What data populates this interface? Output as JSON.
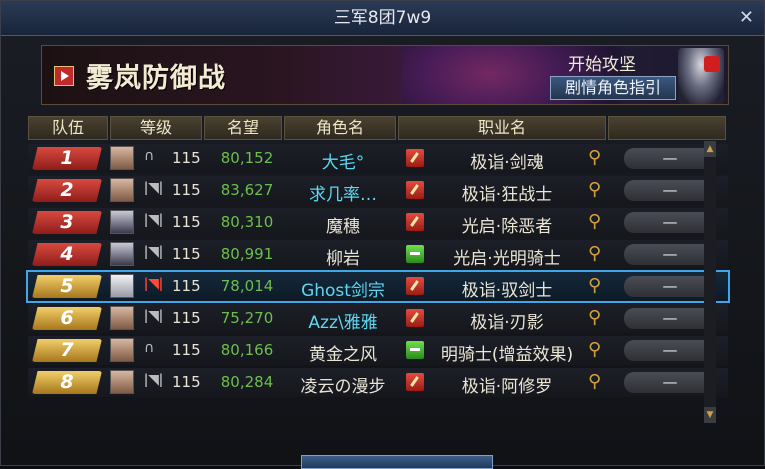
{
  "window": {
    "title": "三军8团7w9",
    "close_label": "✕"
  },
  "banner": {
    "title": "雾岚防御战",
    "start_text": "开始攻坚",
    "guide_button": "剧情角色指引"
  },
  "headers": [
    "队伍",
    "等级",
    "名望",
    "角色名",
    "职业名",
    ""
  ],
  "rows": [
    {
      "team": "1",
      "color": "red",
      "level": "115",
      "fame": "80,152",
      "name": "大毛°",
      "name_color": "cyan",
      "class": "极诣·剑魂",
      "class_icon": "red",
      "action": "—",
      "status_icon": "headset"
    },
    {
      "team": "2",
      "color": "red",
      "level": "115",
      "fame": "83,627",
      "name": "求几率…",
      "name_color": "cyan",
      "class": "极诣·狂战士",
      "class_icon": "red",
      "action": "—",
      "status_icon": "speaker"
    },
    {
      "team": "3",
      "color": "red",
      "level": "115",
      "fame": "80,310",
      "name": "魔穗",
      "name_color": "white",
      "class": "光启·除恶者",
      "class_icon": "red",
      "action": "—",
      "status_icon": "speaker"
    },
    {
      "team": "4",
      "color": "red",
      "level": "115",
      "fame": "80,991",
      "name": "柳岩",
      "name_color": "white",
      "class": "光启·光明骑士",
      "class_icon": "green",
      "action": "—",
      "status_icon": "speaker"
    },
    {
      "team": "5",
      "color": "gold",
      "level": "115",
      "fame": "78,014",
      "name": "Ghost剑宗",
      "name_color": "cyan",
      "class": "极诣·驭剑士",
      "class_icon": "red",
      "action": "—",
      "status_icon": "speaker-red"
    },
    {
      "team": "6",
      "color": "gold",
      "level": "115",
      "fame": "75,270",
      "name": "Azz\\雅雅",
      "name_color": "cyan",
      "class": "极诣·刃影",
      "class_icon": "red",
      "action": "—",
      "status_icon": "speaker"
    },
    {
      "team": "7",
      "color": "gold",
      "level": "115",
      "fame": "80,166",
      "name": "黄金之风",
      "name_color": "white",
      "class": "明骑士(增益效果)",
      "class_icon": "green",
      "action": "—",
      "status_icon": "headset"
    },
    {
      "team": "8",
      "color": "gold",
      "level": "115",
      "fame": "80,284",
      "name": "凌云の漫步",
      "name_color": "white",
      "class": "极诣·阿修罗",
      "class_icon": "red",
      "action": "—",
      "status_icon": "speaker"
    }
  ],
  "selected_row": 5,
  "colors": {
    "accent_blue": "#3fa6e8",
    "fame_green": "#6cbf4c",
    "name_cyan": "#5ed7f2",
    "red_badge": "#b8302a",
    "gold_badge": "#d3a33d"
  }
}
